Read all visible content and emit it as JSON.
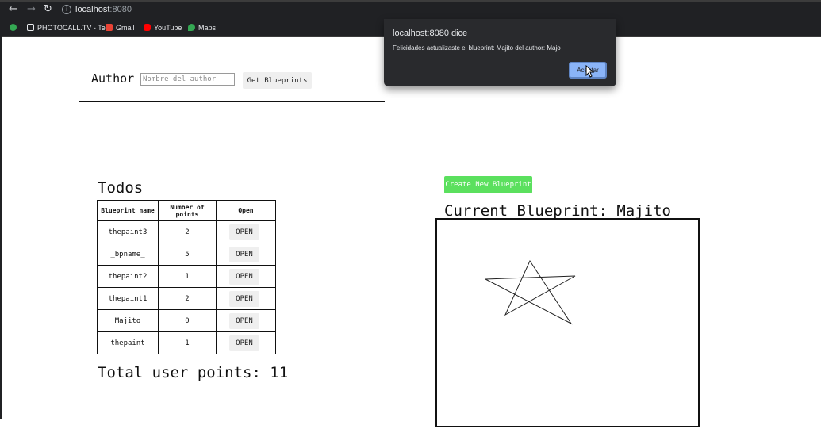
{
  "browser": {
    "url_host": "localhost",
    "url_port": ":8080",
    "bookmarks": [
      {
        "label": "PHOTOCALL.TV - Te...",
        "icon": "tv-icon"
      },
      {
        "label": "Gmail",
        "icon": "gmail-icon"
      },
      {
        "label": "YouTube",
        "icon": "youtube-icon"
      },
      {
        "label": "Maps",
        "icon": "maps-icon"
      }
    ]
  },
  "author": {
    "label": "Author",
    "input_placeholder": "Nombre del author",
    "input_value": "",
    "get_button": "Get Blueprints"
  },
  "todos": {
    "title": "Todos",
    "headers": [
      "Blueprint name",
      "Number of points",
      "Open"
    ],
    "rows": [
      {
        "name": "thepaint3",
        "points": "2",
        "open": "OPEN"
      },
      {
        "name": "_bpname_",
        "points": "5",
        "open": "OPEN"
      },
      {
        "name": "thepaint2",
        "points": "1",
        "open": "OPEN"
      },
      {
        "name": "thepaint1",
        "points": "2",
        "open": "OPEN"
      },
      {
        "name": "Majito",
        "points": "0",
        "open": "OPEN"
      },
      {
        "name": "thepaint",
        "points": "1",
        "open": "OPEN"
      }
    ],
    "total": "Total user points: 11"
  },
  "blueprint": {
    "create_button": "Create New Blueprint",
    "current_title": "Current Blueprint: Majito"
  },
  "dialog": {
    "title": "localhost:8080 dice",
    "message": "Felicidades actualizaste el blueprint: Majito del author: Majo",
    "ok_button": "Aceptar"
  },
  "colors": {
    "chrome": "#202124",
    "create_button": "#5be05e",
    "dialog_bg": "#292a2d",
    "dialog_accent": "#8ab4f8"
  }
}
